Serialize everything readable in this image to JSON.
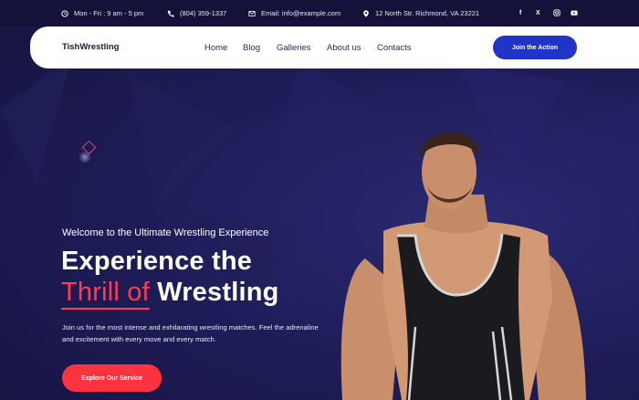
{
  "topbar": {
    "hours": "Mon - Fri : 9 am - 5 pm",
    "phone": "(804) 359-1337",
    "email": "Email: info@example.com",
    "address": "12 North Str. Richmond, VA 23221",
    "social": [
      "f",
      "X",
      "instagram",
      "youtube"
    ]
  },
  "nav": {
    "logo": "TishWrestling",
    "items": [
      "Home",
      "Blog",
      "Galleries",
      "About us",
      "Contacts"
    ],
    "cta": "Join the Action"
  },
  "hero": {
    "kicker": "Welcome to the Ultimate Wrestling Experience",
    "title_line1": "Experience the",
    "title_accent": "Thrill of",
    "title_rest": "Wrestling",
    "body": "Join us for the most intense and exhilarating wrestling matches. Feel the adrenaline and excitement with every move and every match.",
    "button": "Explore Our Service"
  },
  "colors": {
    "accent": "#ff3b52",
    "primary": "#1f35c8",
    "bg": "#1c1a4f"
  }
}
